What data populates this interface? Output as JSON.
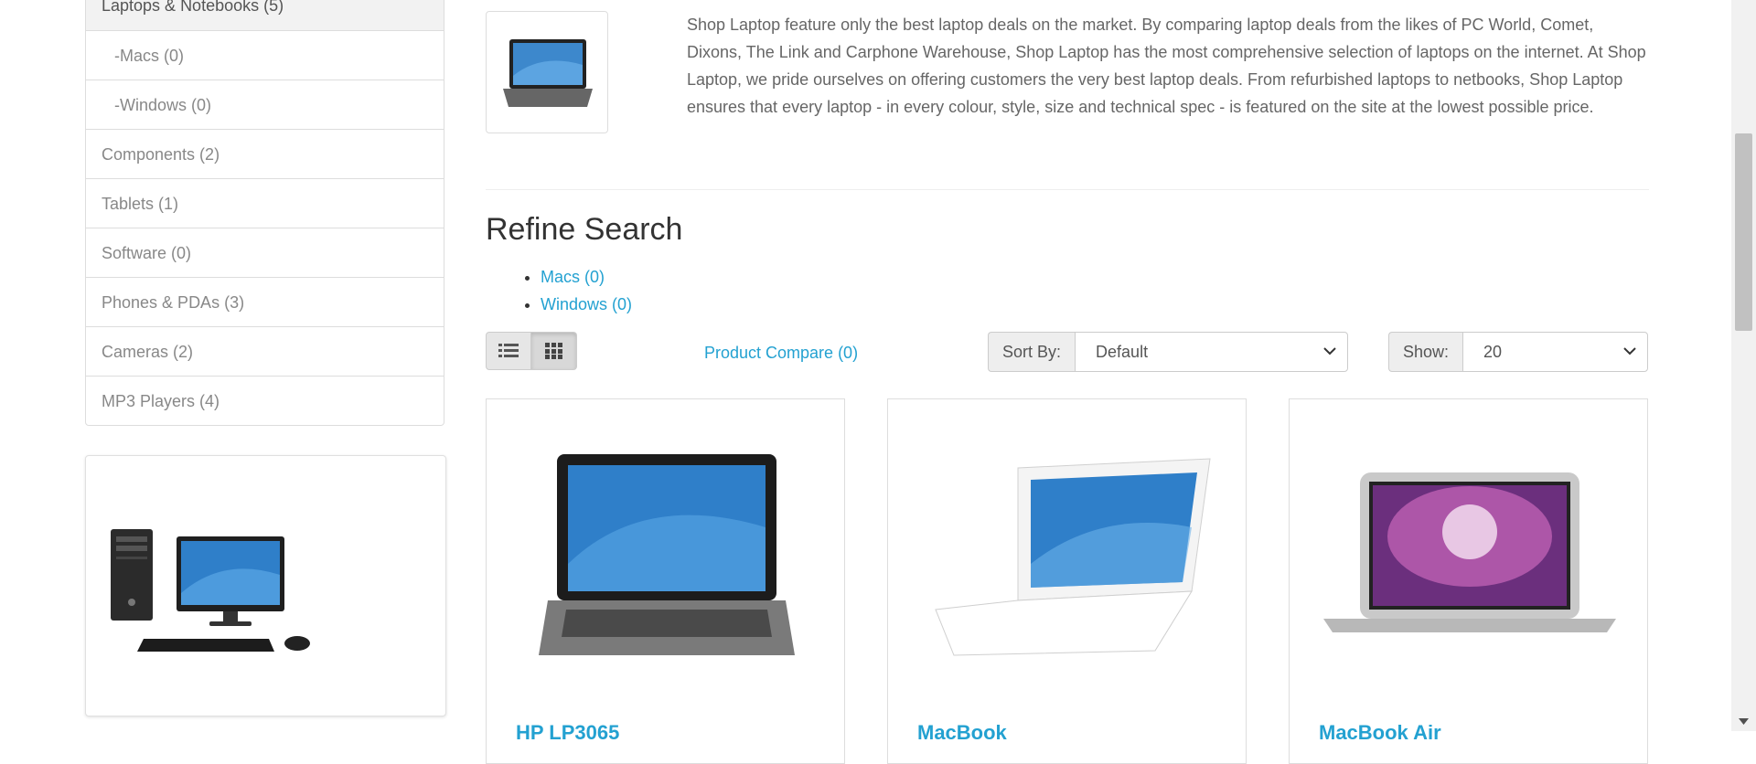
{
  "sidebar": {
    "categories": [
      {
        "label": "Laptops & Notebooks (5)"
      },
      {
        "label": "-Macs (0)"
      },
      {
        "label": "-Windows (0)"
      },
      {
        "label": "Components (2)"
      },
      {
        "label": "Tablets (1)"
      },
      {
        "label": "Software (0)"
      },
      {
        "label": "Phones & PDAs (3)"
      },
      {
        "label": "Cameras (2)"
      },
      {
        "label": "MP3 Players (4)"
      }
    ]
  },
  "category": {
    "description": "Shop Laptop feature only the best laptop deals on the market. By comparing laptop deals from the likes of PC World, Comet, Dixons, The Link and Carphone Warehouse, Shop Laptop has the most comprehensive selection of laptops on the internet. At Shop Laptop, we pride ourselves on offering customers the very best laptop deals. From refurbished laptops to netbooks, Shop Laptop ensures that every laptop - in every colour, style, size and technical spec - is featured on the site at the lowest possible price."
  },
  "refine": {
    "title": "Refine Search",
    "links": [
      {
        "label": "Macs (0)"
      },
      {
        "label": "Windows (0)"
      }
    ]
  },
  "toolbar": {
    "list_view_icon": "list-icon",
    "grid_view_icon": "grid-icon",
    "compare_label": "Product Compare (0)",
    "sort_label": "Sort By:",
    "sort_value": "Default",
    "show_label": "Show:",
    "show_value": "20"
  },
  "products": [
    {
      "name": "HP LP3065"
    },
    {
      "name": "MacBook"
    },
    {
      "name": "MacBook Air"
    }
  ],
  "colors": {
    "link": "#23a1d1",
    "border": "#dddddd",
    "addon_bg": "#eeeeee"
  }
}
